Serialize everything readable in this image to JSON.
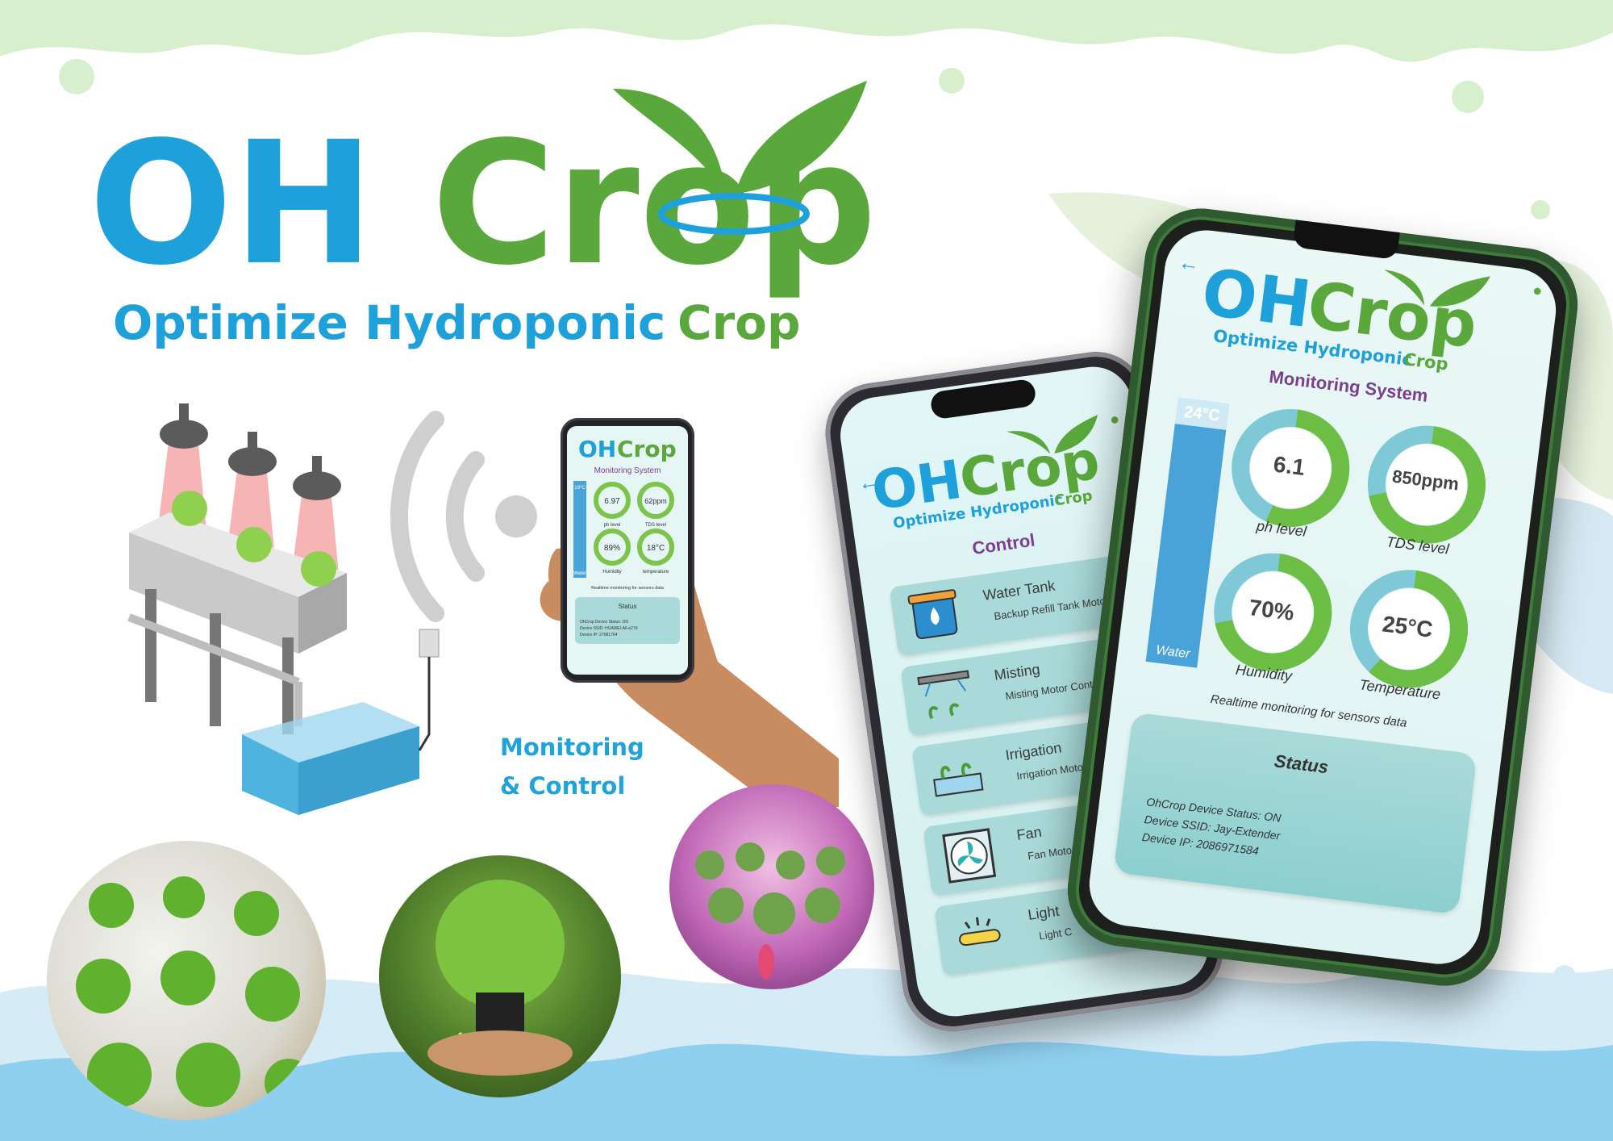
{
  "brand": {
    "logo_oh": "OH",
    "logo_crop": "Crop",
    "tagline_part1": "Optimize Hydroponic",
    "tagline_part2": "Crop",
    "colors": {
      "blue": "#1ea0db",
      "green": "#5aa83b",
      "purple": "#7a3f8f",
      "teal_card": "#a9dad9"
    }
  },
  "section_label": {
    "line1": "Monitoring",
    "line2": "& Control"
  },
  "control_phone": {
    "screen_title": "Control",
    "items": [
      {
        "title": "Water Tank",
        "subtitle": "Backup Refill Tank Motor",
        "icon": "water-tank-icon"
      },
      {
        "title": "Misting",
        "subtitle": "Misting Motor Control",
        "icon": "misting-icon"
      },
      {
        "title": "Irrigation",
        "subtitle": "Irrigation Motor C",
        "icon": "irrigation-icon"
      },
      {
        "title": "Fan",
        "subtitle": "Fan Motor C",
        "icon": "fan-icon"
      },
      {
        "title": "Light",
        "subtitle": "Light C",
        "icon": "light-icon"
      }
    ]
  },
  "monitor_phone": {
    "screen_title": "Monitoring System",
    "water": {
      "value": "24°C",
      "label": "Water",
      "level": 0.9
    },
    "gauges": [
      {
        "value": "6.1",
        "label": "ph level",
        "fill": 0.55
      },
      {
        "value": "850ppm",
        "label": "TDS level",
        "fill": 0.7
      },
      {
        "value": "70%",
        "label": "Humidity",
        "fill": 0.7
      },
      {
        "value": "25°C",
        "label": "Temperature",
        "fill": 0.6
      }
    ],
    "caption": "Realtime monitoring for sensors data",
    "status": {
      "title": "Status",
      "device_status": "OhCrop Device Status: ON",
      "device_ssid": "Device SSID: Jay-Extender",
      "device_ip": "Device IP: 2086971584"
    }
  },
  "hand_phone": {
    "screen_title": "Monitoring System",
    "water": {
      "value": "19°C",
      "label": "Water"
    },
    "gauges": [
      {
        "value": "6.97",
        "label": "ph level"
      },
      {
        "value": "62ppm",
        "label": "TDS level"
      },
      {
        "value": "89%",
        "label": "Humidity"
      },
      {
        "value": "18°C",
        "label": "temperature"
      }
    ],
    "caption": "Realtime monitoring for sensors data",
    "status_title": "Status",
    "status_lines": [
      "OhCrop Device Status: ON",
      "Device SSID: HUAWEI-A6-e27d",
      "Device IP: 27081764"
    ]
  }
}
